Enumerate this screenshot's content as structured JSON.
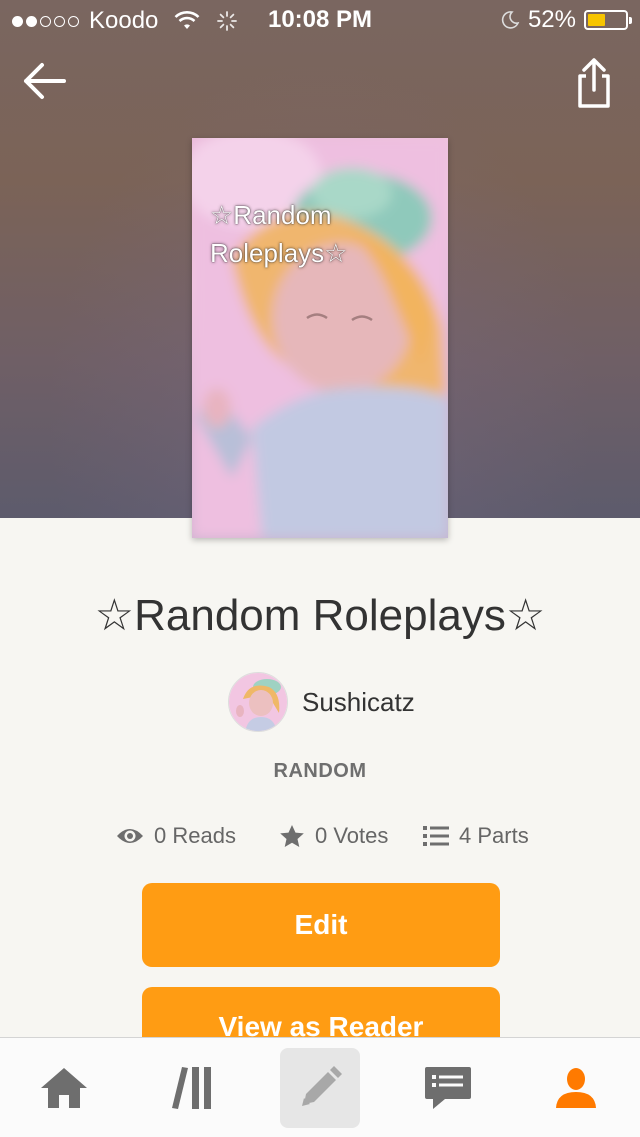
{
  "status_bar": {
    "carrier": "Koodo",
    "time": "10:08 PM",
    "battery_percent": "52%",
    "battery_level": 0.52,
    "signal_bars_filled": 2,
    "signal_bars_total": 5
  },
  "header": {
    "back_icon": "arrow-left-icon",
    "share_icon": "share-icon"
  },
  "cover": {
    "title": "☆Random Roleplays☆"
  },
  "story": {
    "title": "☆Random Roleplays☆",
    "author": "Sushicatz",
    "category": "RANDOM"
  },
  "stats": {
    "reads": "0 Reads",
    "votes": "0 Votes",
    "parts": "4 Parts"
  },
  "buttons": {
    "edit": "Edit",
    "view_as_reader": "View as Reader"
  },
  "tab_bar": {
    "items": [
      {
        "icon": "home-icon",
        "active": false
      },
      {
        "icon": "library-icon",
        "active": false
      },
      {
        "icon": "pencil-icon",
        "active": true
      },
      {
        "icon": "messages-icon",
        "active": false
      },
      {
        "icon": "profile-icon",
        "active": false
      }
    ]
  },
  "colors": {
    "accent": "#ff9c13",
    "battery_fill": "#f7c500",
    "profile_active": "#ff7a00",
    "icon_gray": "#6e6e6e"
  }
}
